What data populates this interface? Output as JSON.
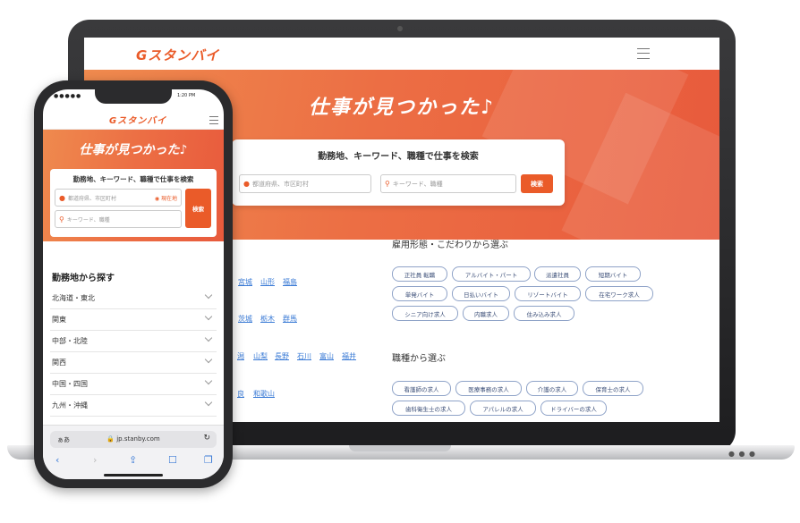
{
  "brand": {
    "logo_text": "Gスタンバイ",
    "accent": "#ea5b29",
    "link_color": "#3b7bd6"
  },
  "desktop": {
    "hero_title": "仕事が見つかった♪",
    "search_title": "勤務地、キーワード、職種で仕事を検索",
    "location_placeholder": "都道府県、市区町村",
    "keyword_placeholder": "キーワード、職種",
    "search_button": "検索",
    "region_links_rows": [
      [
        "宮城",
        "山形",
        "福島"
      ],
      [
        "茨城",
        "栃木",
        "群馬"
      ],
      [
        "潟",
        "山梨",
        "長野",
        "石川",
        "富山",
        "福井"
      ],
      [
        "良",
        "和歌山"
      ]
    ],
    "employment_section_title": "雇用形態・こだわりから選ぶ",
    "employment_chips": [
      "正社員 転職",
      "アルバイト・パート",
      "派遣社員",
      "短期バイト",
      "単発バイト",
      "日払いバイト",
      "リゾートバイト",
      "在宅ワーク求人",
      "シニア向け求人",
      "内職求人",
      "住み込み求人"
    ],
    "occupation_section_title": "職種から選ぶ",
    "occupation_chips": [
      "看護師の求人",
      "医療事務の求人",
      "介護の求人",
      "保育士の求人",
      "歯科衛生士の求人",
      "アパレルの求人",
      "ドライバーの求人"
    ]
  },
  "mobile": {
    "status_left": "●●●●●",
    "status_right": "1:20 PM",
    "hero_title": "仕事が見つかった♪",
    "search_title": "勤務地、キーワード、職種で仕事を検索",
    "location_placeholder": "都道府県、市区町村",
    "current_location": "現在地",
    "keyword_placeholder": "キーワード、職種",
    "search_button": "検索",
    "area_section_title": "勤務地から探す",
    "areas": [
      "北海道・東北",
      "関東",
      "中部・北陸",
      "関西",
      "中国・四国",
      "九州・沖縄"
    ],
    "url_aa": "ぁあ",
    "url": "jp.stanby.com"
  }
}
